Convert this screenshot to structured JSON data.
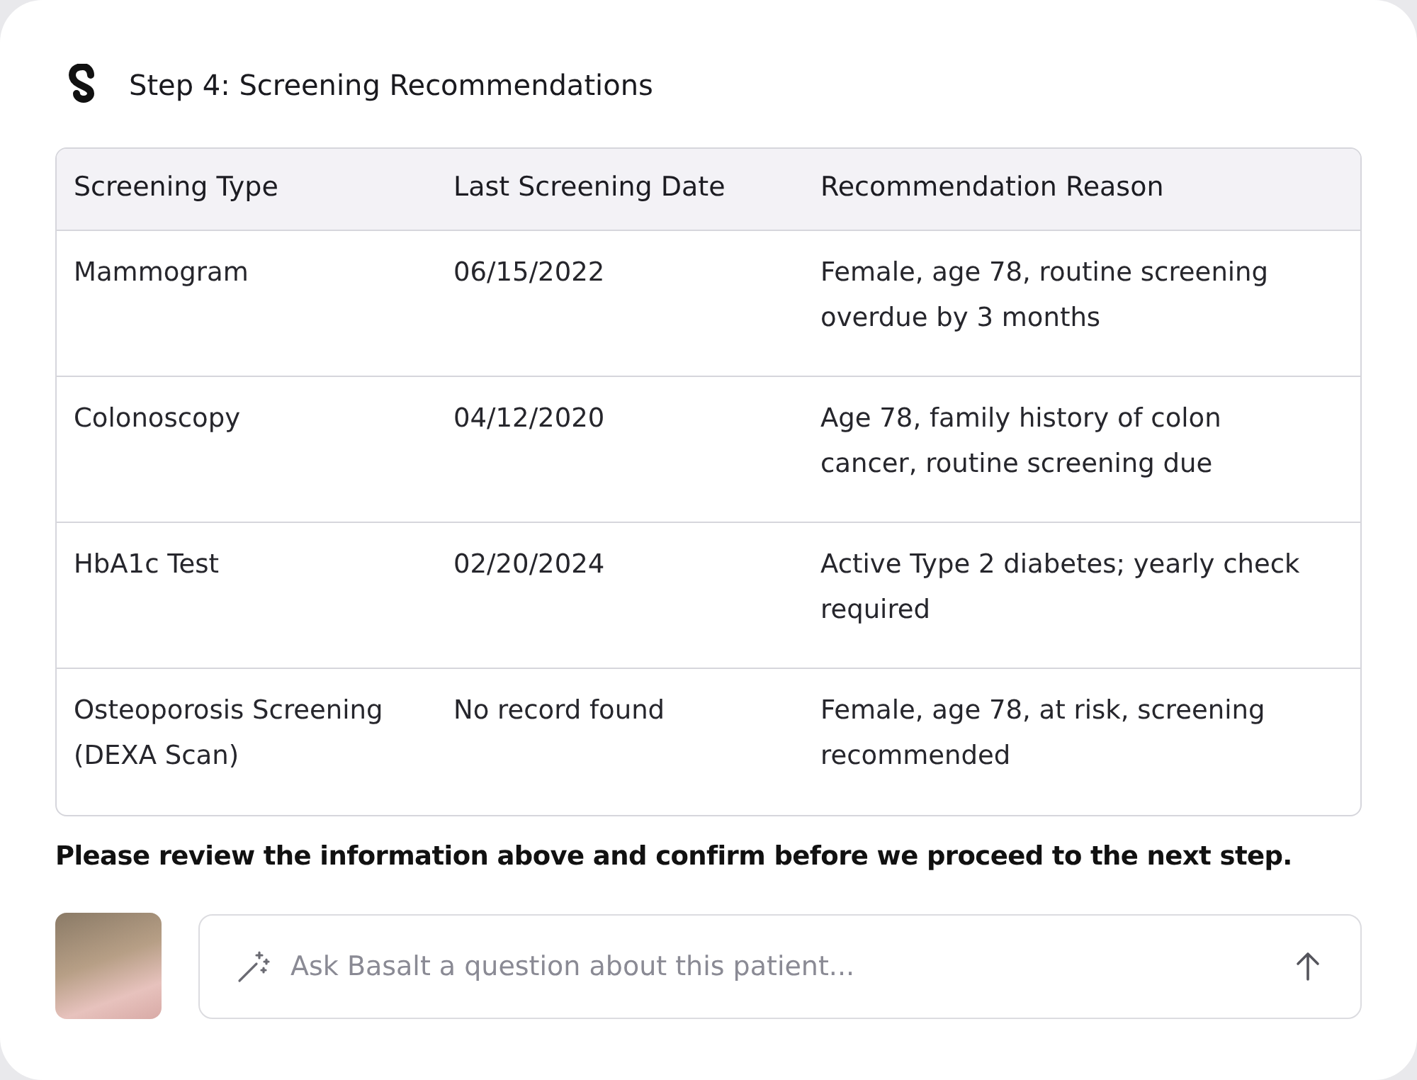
{
  "header": {
    "title": "Step 4: Screening Recommendations"
  },
  "table": {
    "columns": [
      "Screening Type",
      "Last Screening Date",
      "Recommendation Reason"
    ],
    "rows": [
      {
        "cells": [
          "Mammogram",
          "06/15/2022",
          "Female, age 78, routine screening overdue by 3 months"
        ]
      },
      {
        "cells": [
          "Colonoscopy",
          "04/12/2020",
          "Age 78, family history of colon cancer, routine screening due"
        ]
      },
      {
        "cells": [
          "HbA1c Test",
          "02/20/2024",
          "Active Type 2 diabetes; yearly check required"
        ]
      },
      {
        "cells": [
          "Osteoporosis Screening (DEXA Scan)",
          "No record found",
          "Female, age 78, at risk, screening recommended"
        ]
      }
    ]
  },
  "message": "Please review the information above and confirm before we proceed to the next step.",
  "chat": {
    "placeholder": "Ask Basalt a question about this patient..."
  }
}
